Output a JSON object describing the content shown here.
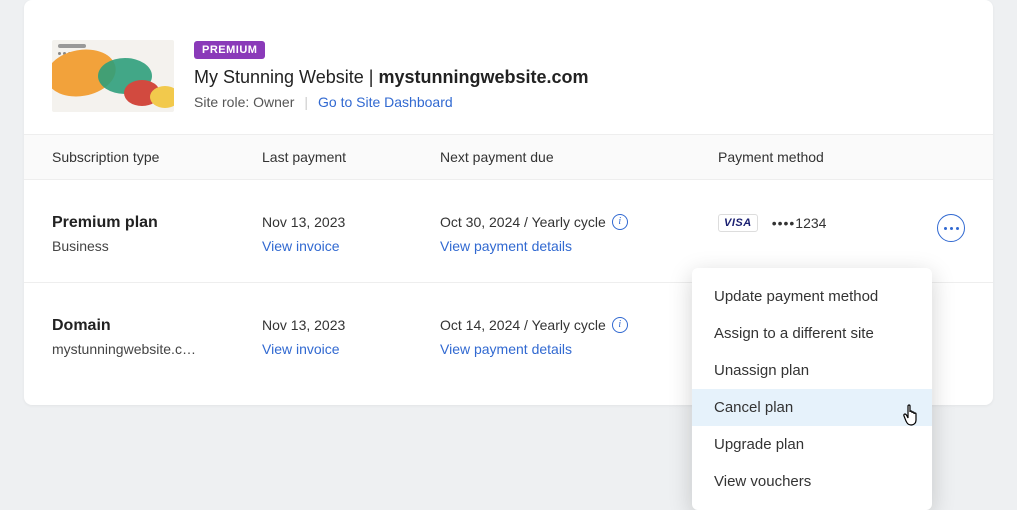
{
  "site": {
    "badge": "PREMIUM",
    "name": "My Stunning Website",
    "domain": "mystunningwebsite.com",
    "role_label": "Site role: Owner",
    "dashboard_link": "Go to Site Dashboard"
  },
  "table": {
    "headers": {
      "subscription": "Subscription type",
      "last_payment": "Last payment",
      "next_payment": "Next payment due",
      "payment_method": "Payment method"
    }
  },
  "rows": [
    {
      "plan_name": "Premium plan",
      "plan_sub": "Business",
      "last_payment_date": "Nov 13, 2023",
      "invoice_link": "View invoice",
      "next_payment": "Oct 30, 2024 / Yearly cycle",
      "payment_details_link": "View payment details",
      "card_brand": "VISA",
      "card_last4": "1234"
    },
    {
      "plan_name": "Domain",
      "plan_sub": "mystunningwebsite.c…",
      "last_payment_date": "Nov 13, 2023",
      "invoice_link": "View invoice",
      "next_payment": "Oct 14, 2024 / Yearly cycle",
      "payment_details_link": "View payment details"
    }
  ],
  "menu": {
    "items": [
      "Update payment method",
      "Assign to a different site",
      "Unassign plan",
      "Cancel plan",
      "Upgrade plan",
      "View vouchers"
    ],
    "hover_index": 3
  },
  "masked_dots": "••••"
}
